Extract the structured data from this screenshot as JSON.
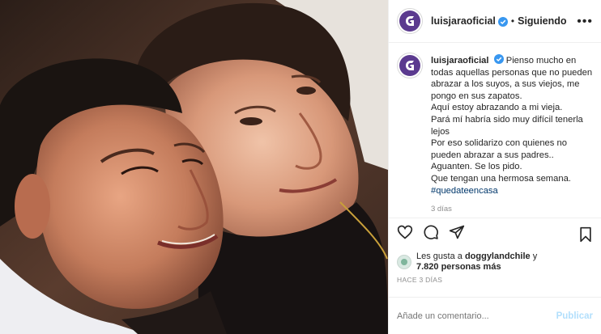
{
  "post": {
    "username": "luisjaraoficial",
    "separator": "•",
    "follow_status": "Siguiendo",
    "more_label": "•••",
    "caption": {
      "username": "luisjaraoficial",
      "lines": [
        "Pienso mucho en todas aquellas personas que no pueden abrazar a los suyos, a sus viejos, me pongo en sus zapatos.",
        "Aquí estoy abrazando a mi vieja.",
        "Pará mí habría sido muy difícil tenerla lejos",
        "Por eso solidarizo con quienes no pueden abrazar a sus padres..",
        "Aguanten. Se los pido.",
        "Que tengan una hermosa semana."
      ],
      "hashtag": "#quedateencasa",
      "time": "3 días"
    },
    "likes": {
      "prefix": "Les gusta a",
      "user": "doggylandchile",
      "suffix_pre": "y",
      "count": "7.820 personas más"
    },
    "age": "HACE 3 DÍAS",
    "comment_placeholder": "Añade un comentario...",
    "publish_label": "Publicar"
  },
  "colors": {
    "link": "#00376b",
    "verified": "#3897f0",
    "avatar_brand": "#5b3a8f",
    "publish_disabled": "#b2dffc"
  },
  "icons": [
    "heart-icon",
    "comment-icon",
    "share-icon",
    "bookmark-icon",
    "verified-badge-icon",
    "more-options-icon"
  ]
}
